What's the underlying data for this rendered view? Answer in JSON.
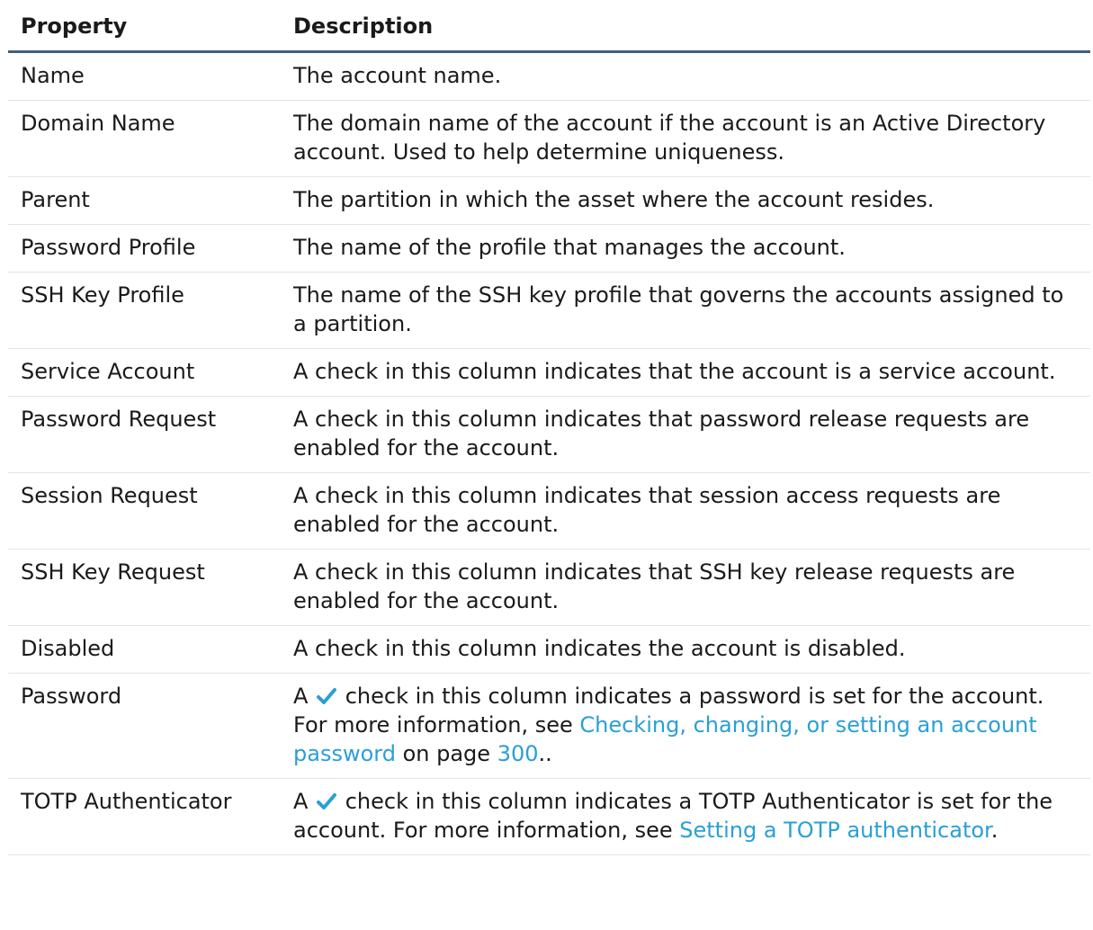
{
  "table": {
    "headers": {
      "property": "Property",
      "description": "Description"
    },
    "rows": [
      {
        "property": "Name",
        "desc": "The account name."
      },
      {
        "property": "Domain Name",
        "desc": "The domain name of the account if the account is an Active Directory account. Used to help determine uniqueness."
      },
      {
        "property": "Parent",
        "desc": "The partition in which the asset where the account resides."
      },
      {
        "property": "Password Profile",
        "desc": "The name of the profile that manages the account."
      },
      {
        "property": "SSH Key Profile",
        "desc": "The name of the SSH key profile that governs the accounts assigned to a partition."
      },
      {
        "property": "Service Account",
        "desc": "A check in this column indicates that the account is a service account."
      },
      {
        "property": "Password Request",
        "desc": "A check in this column indicates that password release requests are enabled for the account."
      },
      {
        "property": "Session Request",
        "desc": "A check in this column indicates that session access requests are enabled for the account."
      },
      {
        "property": "SSH Key Request",
        "desc": "A check in this column indicates that SSH key release requests are enabled for the account."
      },
      {
        "property": "Disabled",
        "desc": "A check in this column indicates the account is disabled."
      },
      {
        "property": "Password",
        "desc_pre": "A",
        "desc_mid": "check in this column indicates a password is set for the account. For more information, see",
        "link1": "Checking, changing, or setting an account password",
        "desc_on_page": "on page",
        "page_link": "300",
        "desc_end": ".."
      },
      {
        "property": "TOTP Authenticator",
        "desc_pre": "A",
        "desc_mid": "check in this column indicates a TOTP Authenticator is set for the account. For more information, see",
        "link1": "Setting a TOTP authenticator",
        "desc_end": "."
      }
    ]
  },
  "colors": {
    "link": "#2a9fd6",
    "check": "#2a9fd6",
    "header_rule": "#3f5f7a"
  },
  "icons": {
    "check": "check-icon"
  }
}
